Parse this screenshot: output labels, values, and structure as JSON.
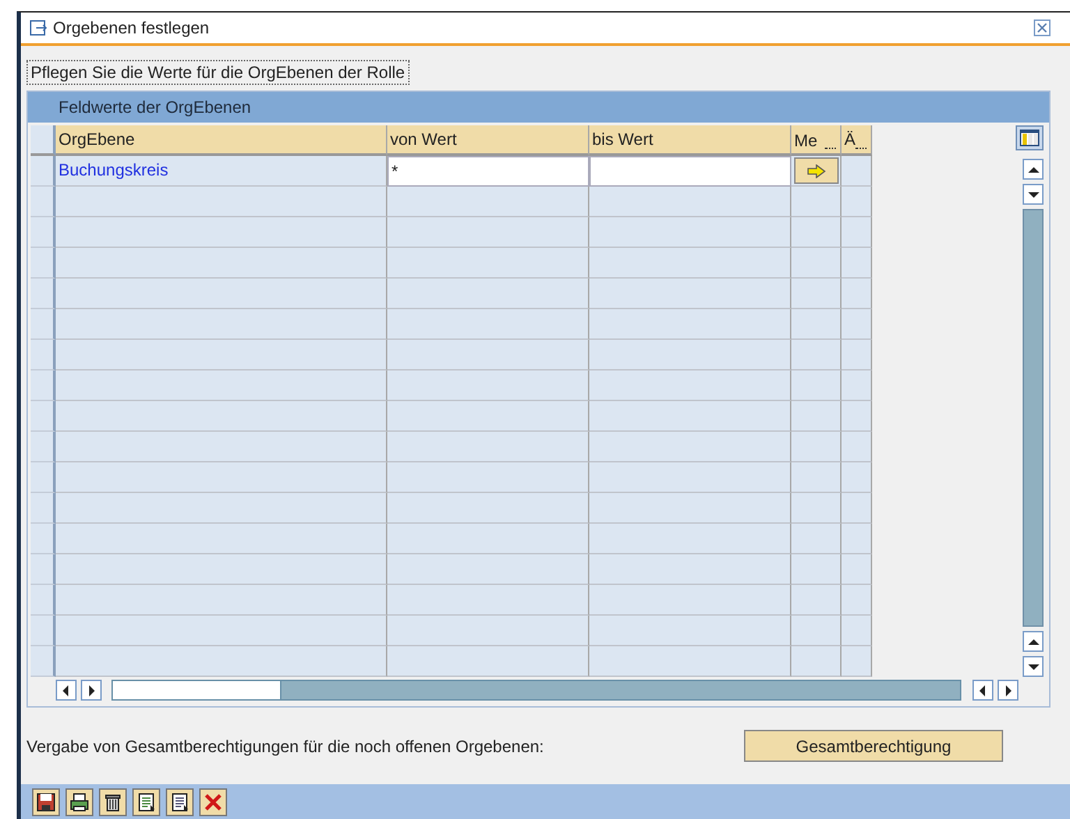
{
  "window": {
    "title": "Orgebenen festlegen"
  },
  "instruction": "Pflegen Sie die Werte für die OrgEbenen der Rolle",
  "table": {
    "title": "Feldwerte der OrgEbenen",
    "columns": [
      "OrgEbene",
      "von Wert",
      "bis Wert",
      "Me",
      "Ä"
    ],
    "rows": [
      {
        "org_ebene": "Buchungskreis",
        "von_wert": "*"
      }
    ]
  },
  "footer": {
    "text": "Vergabe von Gesamtberechtigungen für die noch offenen Orgebenen:",
    "button": "Gesamtberechtigung"
  }
}
